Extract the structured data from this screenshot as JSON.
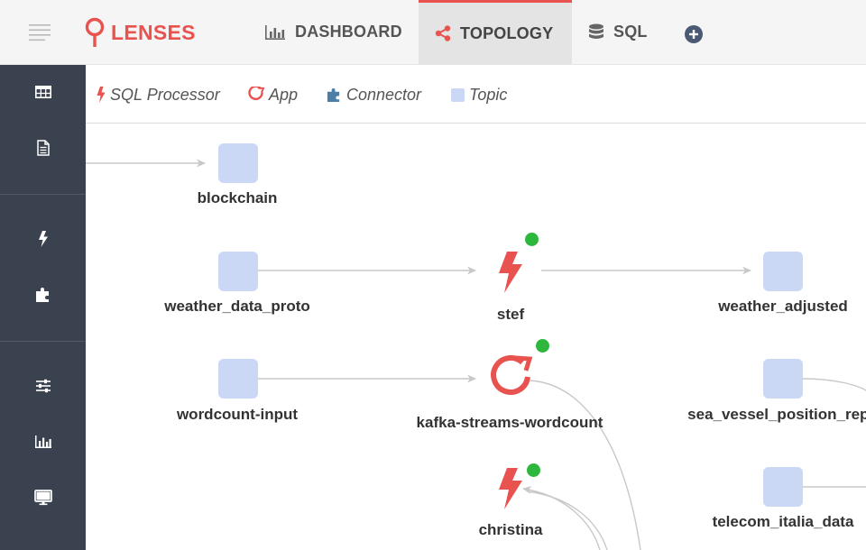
{
  "header": {
    "brand": "LENSES",
    "tabs": [
      {
        "label": "DASHBOARD",
        "icon": "bar-chart-icon"
      },
      {
        "label": "TOPOLOGY",
        "icon": "share-icon",
        "active": true
      },
      {
        "label": "SQL",
        "icon": "database-icon"
      }
    ],
    "add_icon": "plus-circle-icon"
  },
  "sidebar": {
    "items": [
      {
        "icon": "table-icon"
      },
      {
        "icon": "document-icon"
      },
      {
        "icon": "bolt-icon"
      },
      {
        "icon": "puzzle-icon"
      },
      {
        "icon": "sliders-icon"
      },
      {
        "icon": "bar-chart-icon"
      },
      {
        "icon": "monitor-icon"
      }
    ]
  },
  "legend": [
    {
      "label": "SQL Processor",
      "icon": "bolt-icon"
    },
    {
      "label": "App",
      "icon": "app-icon"
    },
    {
      "label": "Connector",
      "icon": "puzzle-icon"
    },
    {
      "label": "Topic",
      "icon": "square-icon"
    }
  ],
  "nodes": [
    {
      "id": "blockchain",
      "label": "blockchain",
      "type": "topic"
    },
    {
      "id": "weather_data_proto",
      "label": "weather_data_proto",
      "type": "topic"
    },
    {
      "id": "stef",
      "label": "stef",
      "type": "processor",
      "status": "running"
    },
    {
      "id": "weather_adjusted",
      "label": "weather_adjusted",
      "type": "topic"
    },
    {
      "id": "wordcount-input",
      "label": "wordcount-input",
      "type": "topic"
    },
    {
      "id": "kafka-streams-wordcount",
      "label": "kafka-streams-wordcount",
      "type": "app",
      "status": "running"
    },
    {
      "id": "sea_vessel_position_repo",
      "label": "sea_vessel_position_repo",
      "type": "topic"
    },
    {
      "id": "christina",
      "label": "christina",
      "type": "processor",
      "status": "running"
    },
    {
      "id": "telecom_italia_data",
      "label": "telecom_italia_data",
      "type": "topic"
    }
  ],
  "colors": {
    "brand": "#e8524f",
    "topic": "#cad8f6",
    "status_ok": "#2db83d",
    "sidebar": "#3a4250",
    "edge": "#c8c8c8"
  }
}
